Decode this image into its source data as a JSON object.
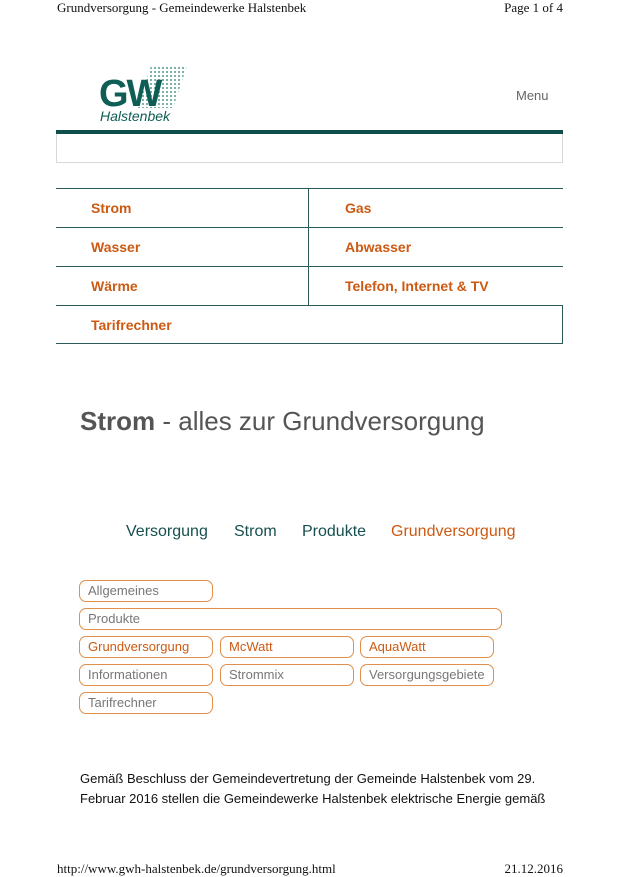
{
  "print_header": {
    "title": "Grundversorgung - Gemeindewerke Halstenbek",
    "page": "Page 1 of 4"
  },
  "print_footer": {
    "url": "http://www.gwh-halstenbek.de/grundversorgung.html",
    "date": "21.12.2016"
  },
  "logo": {
    "initials": "GW",
    "subtitle": "Halstenbek"
  },
  "header": {
    "menu_label": "Menu"
  },
  "search": {
    "placeholder": ""
  },
  "nav": {
    "strom": "Strom",
    "gas": "Gas",
    "wasser": "Wasser",
    "abwasser": "Abwasser",
    "waerme": "Wärme",
    "telefon": "Telefon, Internet & TV",
    "tarifrechner": "Tarifrechner"
  },
  "heading": {
    "bold": "Strom",
    "rest": " - alles zur Grundversorgung"
  },
  "breadcrumb": {
    "b1": "Versorgung",
    "b2": "Strom",
    "b3": "Produkte",
    "b4": "Grundversorgung"
  },
  "subnav": {
    "allgemeines": "Allgemeines",
    "produkte": "Produkte",
    "grundversorgung": "Grundversorgung",
    "mcwatt": "McWatt",
    "aquawatt": "AquaWatt",
    "informationen": "Informationen",
    "strommix": "Strommix",
    "versorgungsgebiete": "Versorgungsgebiete",
    "tarifrechner": "Tarifrechner"
  },
  "content": {
    "line1": "Gemäß Beschluss der Gemeindevertretung der Gemeinde Halstenbek vom 29.",
    "line2": "Februar 2016 stellen die Gemeindewerke Halstenbek elektrische Energie gemäß"
  },
  "colors": {
    "brand_green": "#0f4e4a",
    "accent_orange": "#cc5a12",
    "pill_border": "#e0904a"
  }
}
